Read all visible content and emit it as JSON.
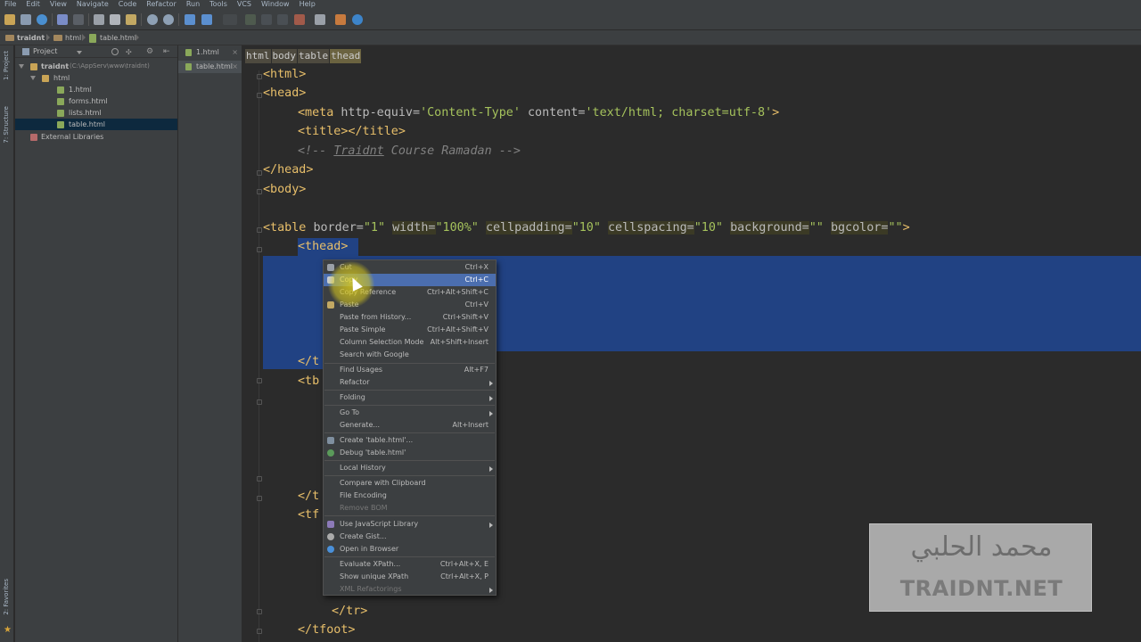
{
  "menubar": {
    "items": [
      "File",
      "Edit",
      "View",
      "Navigate",
      "Code",
      "Refactor",
      "Run",
      "Tools",
      "VCS",
      "Window",
      "Help"
    ]
  },
  "navbar": {
    "crumbs": [
      "traidnt",
      "html",
      "table.html"
    ]
  },
  "side_strip": {
    "project_tab": "1: Project",
    "structure_tab": "7: Structure",
    "favorites_tab": "2: Favorites"
  },
  "project_panel": {
    "header_label": "Project",
    "tree": [
      {
        "label": "traidnt",
        "path": "(C:\\AppServ\\www\\traidnt)",
        "kind": "project"
      },
      {
        "label": "html",
        "kind": "folder"
      },
      {
        "label": "1.html",
        "kind": "file"
      },
      {
        "label": "forms.html",
        "kind": "file"
      },
      {
        "label": "lists.html",
        "kind": "file"
      },
      {
        "label": "table.html",
        "kind": "file",
        "selected": true
      },
      {
        "label": "External Libraries",
        "kind": "library"
      }
    ]
  },
  "open_files": [
    "1.html",
    "table.html"
  ],
  "editor": {
    "breadcrumbs": [
      "html",
      "body",
      "table",
      "thead"
    ],
    "lines": {
      "l1": "<html>",
      "l2": "<head>",
      "l3_tag": "<meta ",
      "l3_attr1": "http-equiv=",
      "l3_val1": "'Content-Type'",
      "l3_attr2": " content=",
      "l3_val2": "'text/html; charset=utf-8'",
      "l3_end": ">",
      "l4": "<title></title>",
      "l5_open": "<!-- ",
      "l5_text": "Traidnt",
      "l5_rest": " Course Ramadan -->",
      "l6": "</head>",
      "l7": "<body>",
      "l8_tag": "<table ",
      "l8_a1": "border=",
      "l8_v1": "\"1\"",
      "l8_a2": "width=",
      "l8_v2": "\"100%\"",
      "l8_a3": "cellpadding=",
      "l8_v3": "\"10\"",
      "l8_a4": "cellspacing=",
      "l8_v4": "\"10\"",
      "l8_a5": "background=",
      "l8_v5": "\"\"",
      "l8_a6": "bgcolor=",
      "l8_v6": "\"\"",
      "l8_end": ">",
      "l9": "<thead>",
      "l10": "</t",
      "l11": "<tb",
      "l12": "</t",
      "l13": "<tf",
      "l14": "</tr>",
      "l15": "</tfoot>"
    }
  },
  "context_menu": {
    "items": [
      {
        "label": "Cut",
        "shortcut": "Ctrl+X"
      },
      {
        "label": "Copy",
        "shortcut": "Ctrl+C"
      },
      {
        "label": "Copy Reference",
        "shortcut": "Ctrl+Alt+Shift+C"
      },
      {
        "label": "Paste",
        "shortcut": "Ctrl+V"
      },
      {
        "label": "Paste from History...",
        "shortcut": "Ctrl+Shift+V"
      },
      {
        "label": "Paste Simple",
        "shortcut": "Ctrl+Alt+Shift+V"
      },
      {
        "label": "Column Selection Mode",
        "shortcut": "Alt+Shift+Insert"
      },
      {
        "label": "Search with Google",
        "shortcut": ""
      },
      {
        "label": "Find Usages",
        "shortcut": "Alt+F7"
      },
      {
        "label": "Refactor",
        "shortcut": ""
      },
      {
        "label": "Folding",
        "shortcut": ""
      },
      {
        "label": "Go To",
        "shortcut": ""
      },
      {
        "label": "Generate...",
        "shortcut": "Alt+Insert"
      },
      {
        "label": "Create 'table.html'...",
        "shortcut": ""
      },
      {
        "label": "Debug 'table.html'",
        "shortcut": ""
      },
      {
        "label": "Local History",
        "shortcut": ""
      },
      {
        "label": "Compare with Clipboard",
        "shortcut": ""
      },
      {
        "label": "File Encoding",
        "shortcut": ""
      },
      {
        "label": "Remove BOM",
        "shortcut": ""
      },
      {
        "label": "Use JavaScript Library",
        "shortcut": ""
      },
      {
        "label": "Create Gist...",
        "shortcut": ""
      },
      {
        "label": "Open in Browser",
        "shortcut": ""
      },
      {
        "label": "Evaluate XPath...",
        "shortcut": "Ctrl+Alt+X, E"
      },
      {
        "label": "Show unique XPath",
        "shortcut": "Ctrl+Alt+X, P"
      },
      {
        "label": "XML Refactorings",
        "shortcut": ""
      }
    ]
  },
  "watermark": {
    "arabic": "محمد الحلبي",
    "latin": "TRAIDNT.NET"
  },
  "colors": {
    "selection": "#214283",
    "menu_highlight": "#4b6eaf",
    "tag": "#e8bf6a",
    "string": "#a5c25c"
  }
}
